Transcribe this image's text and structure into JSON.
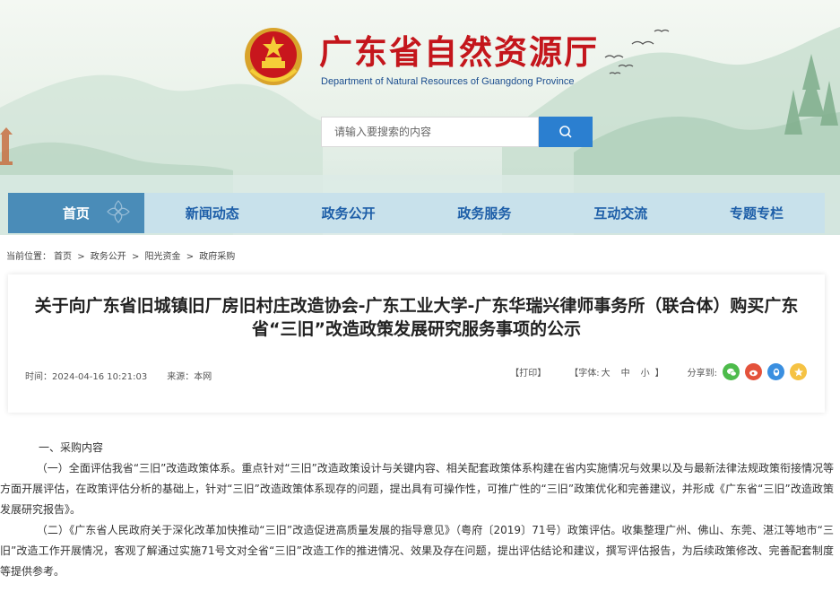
{
  "site": {
    "title": "广东省自然资源厅",
    "subtitle": "Department of Natural Resources of Guangdong Province"
  },
  "search": {
    "placeholder": "请输入要搜索的内容"
  },
  "nav": {
    "items": [
      {
        "label": "首页",
        "active": true
      },
      {
        "label": "新闻动态",
        "active": false
      },
      {
        "label": "政务公开",
        "active": false
      },
      {
        "label": "政务服务",
        "active": false
      },
      {
        "label": "互动交流",
        "active": false
      },
      {
        "label": "专题专栏",
        "active": false
      }
    ]
  },
  "breadcrumb": {
    "prefix": "当前位置：",
    "items": [
      "首页",
      "政务公开",
      "阳光资金",
      "政府采购"
    ],
    "separator": ">"
  },
  "article": {
    "title": "关于向广东省旧城镇旧厂房旧村庄改造协会-广东工业大学-广东华瑞兴律师事务所（联合体）购买广东省“三旧”改造政策发展研究服务事项的公示",
    "time_label": "时间：",
    "time": "2024-04-16 10:21:03",
    "source_label": "来源：",
    "source": "本网",
    "print": "【打印】",
    "font_size_label": "【字体:",
    "font_large": "大",
    "font_medium": "中",
    "font_small": "小",
    "font_close": "】",
    "share_label": "分享到:",
    "share_icons": [
      "wechat-icon",
      "weibo-icon",
      "qq-icon",
      "qzone-icon"
    ]
  },
  "content": {
    "section1_heading": "一、采购内容",
    "para1": "（一）全面评估我省“三旧”改造政策体系。重点针对“三旧”改造政策设计与关键内容、相关配套政策体系构建在省内实施情况与效果以及与最新法律法规政策衔接情况等方面开展评估，在政策评估分析的基础上，针对“三旧”改造政策体系现存的问题，提出具有可操作性，可推广性的“三旧”政策优化和完善建议，并形成《广东省“三旧”改造政策发展研究报告》。",
    "para2": "（二）《广东省人民政府关于深化改革加快推动“三旧”改造促进高质量发展的指导意见》（粤府〔2019〕71号）政策评估。收集整理广州、佛山、东莞、湛江等地市“三旧”改造工作开展情况，客观了解通过实施71号文对全省“三旧”改造工作的推进情况、效果及存在问题，提出评估结论和建议，撰写评估报告，为后续政策修改、完善配套制度等提供参考。"
  },
  "colors": {
    "title_red": "#c4161c",
    "nav_bg": "#c8e1eb",
    "nav_active": "#4a8cb8",
    "nav_text": "#1d5ea8",
    "search_button": "#2b7fd0"
  }
}
